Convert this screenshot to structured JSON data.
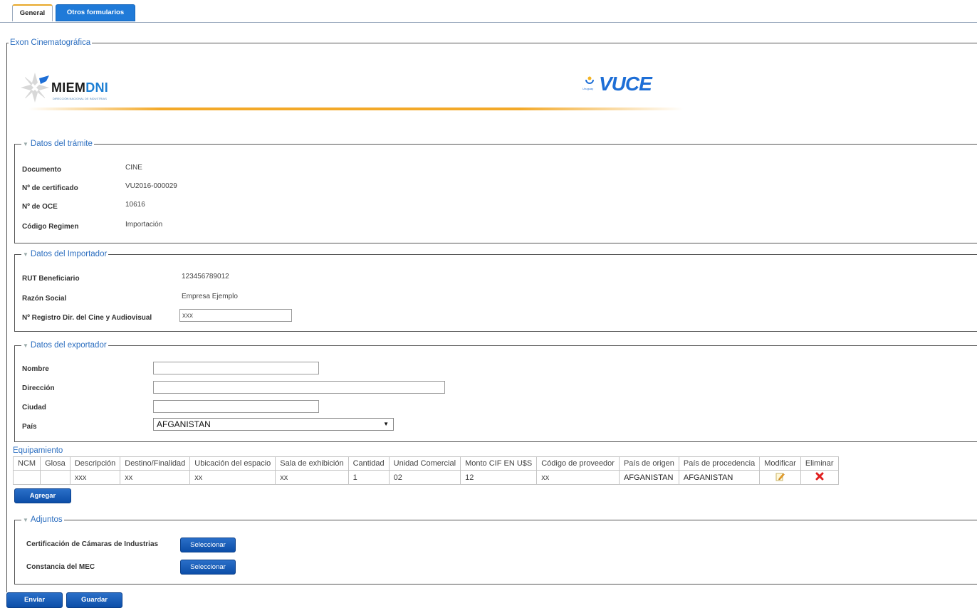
{
  "tabs": [
    {
      "label": "General"
    },
    {
      "label": "Otros formularios"
    }
  ],
  "form_title": "Exon Cinematográfica",
  "logos": {
    "left_brand": "MIEMDNI",
    "left_subtitle": "DIRECCIÓN NACIONAL DE INDUSTRIAS",
    "right_brand": "VUCE",
    "right_country": "Uruguay"
  },
  "tramite": {
    "legend": "Datos del trámite",
    "rows": [
      {
        "label": "Documento",
        "value": "CINE"
      },
      {
        "label": "Nº de certificado",
        "value": "VU2016-000029"
      },
      {
        "label": "Nº de OCE",
        "value": "10616"
      },
      {
        "label": "Código Regimen",
        "value": "Importación"
      }
    ]
  },
  "importador": {
    "legend": "Datos del Importador",
    "rut_label": "RUT Beneficiario",
    "rut_value": "123456789012",
    "razon_label": "Razón Social",
    "razon_value": "Empresa Ejemplo",
    "registro_label": "Nº Registro Dir. del Cine y Audiovisual",
    "registro_value": "xxx"
  },
  "exportador": {
    "legend": "Datos del exportador",
    "nombre_label": "Nombre",
    "nombre_value": "",
    "direccion_label": "Dirección",
    "direccion_value": "",
    "ciudad_label": "Ciudad",
    "ciudad_value": "",
    "pais_label": "País",
    "pais_value": "AFGANISTAN"
  },
  "equipamiento": {
    "title": "Equipamiento",
    "columns": [
      "NCM",
      "Glosa",
      "Descripción",
      "Destino/Finalidad",
      "Ubicación del espacio",
      "Sala de exhibición",
      "Cantidad",
      "Unidad Comercial",
      "Monto CIF EN U$S",
      "Código de proveedor",
      "País de origen",
      "País de procedencia",
      "Modificar",
      "Eliminar"
    ],
    "rows": [
      {
        "ncm": "",
        "glosa": "",
        "descripcion": "xxx",
        "destino": "xx",
        "ubicacion": "xx",
        "sala": "xx",
        "cantidad": "1",
        "unidad": "02",
        "monto": "12",
        "proveedor": "xx",
        "origen": "AFGANISTAN",
        "procedencia": "AFGANISTAN"
      }
    ],
    "add_label": "Agregar"
  },
  "adjuntos": {
    "legend": "Adjuntos",
    "items": [
      {
        "label": "Certificación de Cámaras de Industrias",
        "button": "Seleccionar"
      },
      {
        "label": "Constancia del MEC",
        "button": "Seleccionar"
      }
    ]
  },
  "footer": {
    "send_label": "Enviar",
    "save_label": "Guardar"
  },
  "colors": {
    "accent_blue": "#1f7ad8",
    "legend_blue": "#2d6fc0",
    "tab_orange": "#e8a82a",
    "delete_red": "#e02020"
  }
}
